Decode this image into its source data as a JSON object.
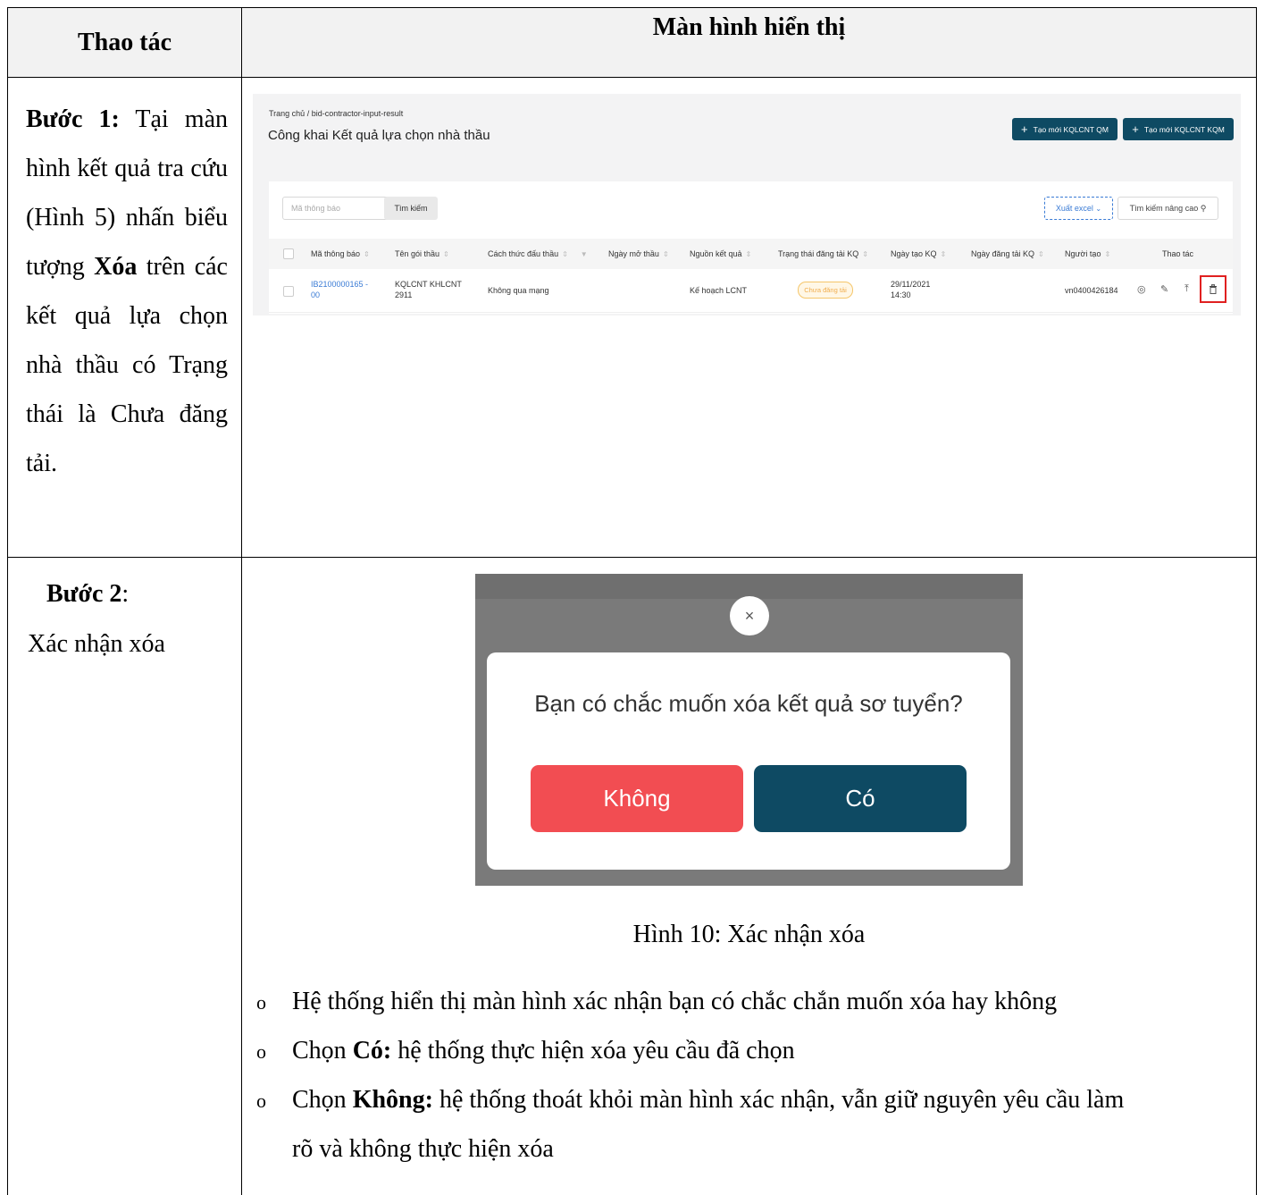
{
  "header": {
    "left": "Thao tác",
    "right": "Màn hình hiển thị"
  },
  "step1": {
    "bold_label": "Bước 1:",
    "text_a": " Tại màn hình kết quả tra cứu (Hình 5) nhấn biểu tượng ",
    "bold_action": "Xóa",
    "text_b": " trên các kết quả lựa chọn nhà thầu có Trạng thái là Chưa đăng tải."
  },
  "step2": {
    "label": "Bước 2",
    "colon": ":",
    "body": "Xác nhận xóa"
  },
  "app": {
    "breadcrumb": "Trang chủ  /  bid-contractor-input-result",
    "title": "Công khai Kết quả lựa chọn nhà thầu",
    "btn_qm": "Tạo mới KQLCNT QM",
    "btn_kqm": "Tạo mới KQLCNT KQM",
    "input_placeholder": "Mã thông báo",
    "search_label": "Tìm kiếm",
    "excel_label": "Xuất excel",
    "advanced_label": "Tìm kiếm nâng cao",
    "columns": [
      "Mã thông báo",
      "Tên gói thầu",
      "Cách thức đấu thầu",
      "Ngày mở thầu",
      "Nguồn kết quả",
      "Trạng thái đăng tải KQ",
      "Ngày tạo KQ",
      "Ngày đăng tải KQ",
      "Người tạo",
      "Thao tác"
    ],
    "row": {
      "code_line1": "IB2100000165 -",
      "code_line2": "00",
      "package_line1": "KQLCNT KHLCNT",
      "package_line2": "2911",
      "method": "Không qua mạng",
      "source": "Kế hoạch LCNT",
      "status": "Chưa đăng tải",
      "created_line1": "29/11/2021",
      "created_line2": "14:30",
      "creator": "vn0400426184"
    }
  },
  "modal": {
    "close_glyph": "×",
    "question": "Bạn có chắc muốn xóa kết quả sơ tuyển?",
    "no_label": "Không",
    "yes_label": "Có"
  },
  "caption": "Hình 10: Xác nhận xóa",
  "bullets": {
    "b1": "Hệ thống hiển thị màn hình xác nhận bạn có chắc chắn muốn xóa hay không",
    "b2_prefix": "Chọn ",
    "b2_bold": "Có:",
    "b2_rest": " hệ thống thực hiện xóa yêu cầu đã chọn",
    "b3_prefix": "Chọn ",
    "b3_bold": "Không:",
    "b3_rest": " hệ thống thoát khỏi màn hình xác nhận, vẫn giữ nguyên yêu cầu làm",
    "b3_line2": "rõ và không thực hiện xóa",
    "marker": "o"
  },
  "colors": {
    "primary": "#0e4a63",
    "danger": "#f24d52",
    "highlight": "#e02020",
    "link": "#3a7bd5"
  }
}
